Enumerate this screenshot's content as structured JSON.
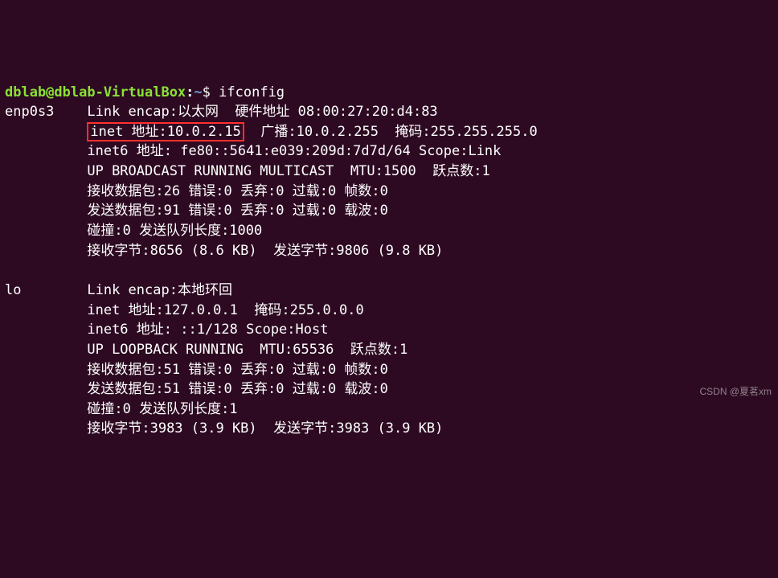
{
  "prompt": {
    "user_host": "dblab@dblab-VirtualBox",
    "colon": ":",
    "path": "~",
    "dollar": "$ "
  },
  "command": "ifconfig",
  "iface1": {
    "name": "enp0s3",
    "pad": "    ",
    "l1a": "Link encap:以太网  硬件地址 ",
    "l1b": "08:00:27:20:d4:83",
    "indent": "          ",
    "l2_hl": "inet 地址:10.0.2.15",
    "l2_rest": "  广播:10.0.2.255  掩码:255.255.255.0",
    "l3": "inet6 地址: fe80::5641:e039:209d:7d7d/64 Scope:Link",
    "l4": "UP BROADCAST RUNNING MULTICAST  MTU:1500  跃点数:1",
    "l5": "接收数据包:26 错误:0 丢弃:0 过载:0 帧数:0",
    "l6": "发送数据包:91 错误:0 丢弃:0 过载:0 载波:0",
    "l7": "碰撞:0 发送队列长度:1000",
    "l8": "接收字节:8656 (8.6 KB)  发送字节:9806 (9.8 KB)"
  },
  "blank": " ",
  "iface2": {
    "name": "lo",
    "pad": "        ",
    "l1": "Link encap:本地环回",
    "indent": "          ",
    "l2": "inet 地址:127.0.0.1  掩码:255.0.0.0",
    "l3": "inet6 地址: ::1/128 Scope:Host",
    "l4": "UP LOOPBACK RUNNING  MTU:65536  跃点数:1",
    "l5": "接收数据包:51 错误:0 丢弃:0 过载:0 帧数:0",
    "l6": "发送数据包:51 错误:0 丢弃:0 过载:0 载波:0",
    "l7": "碰撞:0 发送队列长度:1",
    "l8": "接收字节:3983 (3.9 KB)  发送字节:3983 (3.9 KB)"
  },
  "watermark": "CSDN @夏茗xm"
}
